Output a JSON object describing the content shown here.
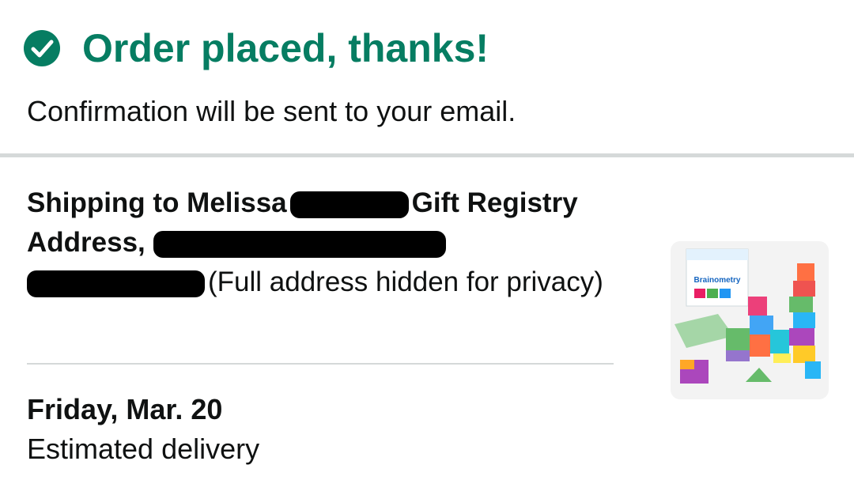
{
  "header": {
    "title": "Order placed, thanks!",
    "subtitle": "Confirmation will be sent to your email.",
    "check_icon": "check-circle-icon",
    "accent_color": "#067d62"
  },
  "shipping": {
    "prefix": "Shipping to Melissa",
    "middle": "Gift Registry Address,",
    "suffix": "(Full address hidden for privacy)"
  },
  "product": {
    "name": "Brainometry",
    "image_icon": "product-thumbnail"
  },
  "delivery": {
    "date": "Friday, Mar. 20",
    "label": "Estimated delivery"
  }
}
